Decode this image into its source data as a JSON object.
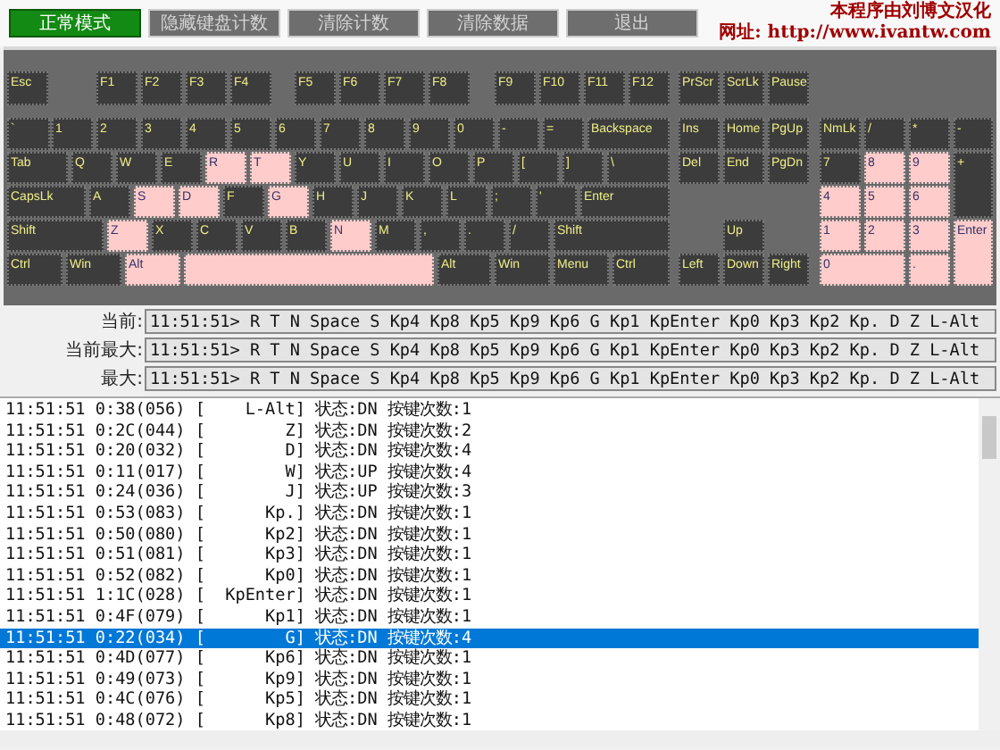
{
  "toolbar": {
    "buttons": [
      {
        "label": "正常模式",
        "selected": true,
        "disabled": false
      },
      {
        "label": "隐藏键盘计数",
        "selected": false,
        "disabled": true
      },
      {
        "label": "清除计数",
        "selected": false,
        "disabled": true
      },
      {
        "label": "清除数据",
        "selected": false,
        "disabled": true
      },
      {
        "label": "退出",
        "selected": false,
        "disabled": true
      }
    ],
    "credits": [
      "本程序由刘博文汉化",
      "网址: http://www.ivantw.com"
    ]
  },
  "keyboard": {
    "keys": [
      {
        "label": "Esc",
        "pressed": false
      },
      {
        "label": "F1",
        "pressed": false
      },
      {
        "label": "F2",
        "pressed": false
      },
      {
        "label": "F3",
        "pressed": false
      },
      {
        "label": "F4",
        "pressed": false
      },
      {
        "label": "F5",
        "pressed": false
      },
      {
        "label": "F6",
        "pressed": false
      },
      {
        "label": "F7",
        "pressed": false
      },
      {
        "label": "F8",
        "pressed": false
      },
      {
        "label": "F9",
        "pressed": false
      },
      {
        "label": "F10",
        "pressed": false
      },
      {
        "label": "F11",
        "pressed": false
      },
      {
        "label": "F12",
        "pressed": false
      },
      {
        "label": "PrScr",
        "pressed": false
      },
      {
        "label": "ScrLk",
        "pressed": false
      },
      {
        "label": "Pause",
        "pressed": false
      },
      {
        "label": "`",
        "pressed": false
      },
      {
        "label": "1",
        "pressed": false
      },
      {
        "label": "2",
        "pressed": false
      },
      {
        "label": "3",
        "pressed": false
      },
      {
        "label": "4",
        "pressed": false
      },
      {
        "label": "5",
        "pressed": false
      },
      {
        "label": "6",
        "pressed": false
      },
      {
        "label": "7",
        "pressed": false
      },
      {
        "label": "8",
        "pressed": false
      },
      {
        "label": "9",
        "pressed": false
      },
      {
        "label": "0",
        "pressed": false
      },
      {
        "label": "-",
        "pressed": false
      },
      {
        "label": "=",
        "pressed": false
      },
      {
        "label": "Backspace",
        "pressed": false
      },
      {
        "label": "Ins",
        "pressed": false
      },
      {
        "label": "Home",
        "pressed": false
      },
      {
        "label": "PgUp",
        "pressed": false
      },
      {
        "label": "NmLk",
        "pressed": false
      },
      {
        "label": "/",
        "pressed": false
      },
      {
        "label": "*",
        "pressed": false
      },
      {
        "label": "-",
        "pressed": false
      },
      {
        "label": "Tab",
        "pressed": false
      },
      {
        "label": "Q",
        "pressed": false
      },
      {
        "label": "W",
        "pressed": false
      },
      {
        "label": "E",
        "pressed": false
      },
      {
        "label": "R",
        "pressed": true
      },
      {
        "label": "T",
        "pressed": true
      },
      {
        "label": "Y",
        "pressed": false
      },
      {
        "label": "U",
        "pressed": false
      },
      {
        "label": "I",
        "pressed": false
      },
      {
        "label": "O",
        "pressed": false
      },
      {
        "label": "P",
        "pressed": false
      },
      {
        "label": "[",
        "pressed": false
      },
      {
        "label": "]",
        "pressed": false
      },
      {
        "label": "\\",
        "pressed": false
      },
      {
        "label": "Del",
        "pressed": false
      },
      {
        "label": "End",
        "pressed": false
      },
      {
        "label": "PgDn",
        "pressed": false
      },
      {
        "label": "7",
        "pressed": false
      },
      {
        "label": "8",
        "pressed": true
      },
      {
        "label": "9",
        "pressed": true
      },
      {
        "label": "+",
        "pressed": false
      },
      {
        "label": "CapsLk",
        "pressed": false
      },
      {
        "label": "A",
        "pressed": false
      },
      {
        "label": "S",
        "pressed": true
      },
      {
        "label": "D",
        "pressed": true
      },
      {
        "label": "F",
        "pressed": false
      },
      {
        "label": "G",
        "pressed": true
      },
      {
        "label": "H",
        "pressed": false
      },
      {
        "label": "J",
        "pressed": false
      },
      {
        "label": "K",
        "pressed": false
      },
      {
        "label": "L",
        "pressed": false
      },
      {
        "label": ";",
        "pressed": false
      },
      {
        "label": "'",
        "pressed": false
      },
      {
        "label": "Enter",
        "pressed": false
      },
      {
        "label": "4",
        "pressed": true
      },
      {
        "label": "5",
        "pressed": true
      },
      {
        "label": "6",
        "pressed": true
      },
      {
        "label": "Shift",
        "pressed": false
      },
      {
        "label": "Z",
        "pressed": true
      },
      {
        "label": "X",
        "pressed": false
      },
      {
        "label": "C",
        "pressed": false
      },
      {
        "label": "V",
        "pressed": false
      },
      {
        "label": "B",
        "pressed": false
      },
      {
        "label": "N",
        "pressed": true
      },
      {
        "label": "M",
        "pressed": false
      },
      {
        "label": ",",
        "pressed": false
      },
      {
        "label": ".",
        "pressed": false
      },
      {
        "label": "/",
        "pressed": false
      },
      {
        "label": "Shift",
        "pressed": false
      },
      {
        "label": "Up",
        "pressed": false
      },
      {
        "label": "1",
        "pressed": true
      },
      {
        "label": "2",
        "pressed": true
      },
      {
        "label": "3",
        "pressed": true
      },
      {
        "label": "Enter",
        "pressed": true
      },
      {
        "label": "Ctrl",
        "pressed": false
      },
      {
        "label": "Win",
        "pressed": false
      },
      {
        "label": "Alt",
        "pressed": true
      },
      {
        "pressed": true
      },
      {
        "label": "Alt",
        "pressed": false
      },
      {
        "label": "Win",
        "pressed": false
      },
      {
        "label": "Menu",
        "pressed": false
      },
      {
        "label": "Ctrl",
        "pressed": false
      },
      {
        "label": "Left",
        "pressed": false
      },
      {
        "label": "Down",
        "pressed": false
      },
      {
        "label": "Right",
        "pressed": false
      },
      {
        "label": "0",
        "pressed": true
      },
      {
        "label": ".",
        "pressed": true
      }
    ]
  },
  "readouts": [
    {
      "label": "当前:",
      "value": "11:51:51> R T N Space S Kp4 Kp8 Kp5 Kp9 Kp6 G Kp1 KpEnter Kp0 Kp3 Kp2 Kp. D Z L-Alt"
    },
    {
      "label": "当前最大:",
      "value": "11:51:51> R T N Space S Kp4 Kp8 Kp5 Kp9 Kp6 G Kp1 KpEnter Kp0 Kp3 Kp2 Kp. D Z L-Alt"
    },
    {
      "label": "最大:",
      "value": "11:51:51> R T N Space S Kp4 Kp8 Kp5 Kp9 Kp6 G Kp1 KpEnter Kp0 Kp3 Kp2 Kp. D Z L-Alt"
    }
  ],
  "log": [
    {
      "text": "11:51:51 0:38(056) [    L-Alt] 状态:DN 按键次数:1",
      "selected": false
    },
    {
      "text": "11:51:51 0:2C(044) [        Z] 状态:DN 按键次数:2",
      "selected": false
    },
    {
      "text": "11:51:51 0:20(032) [        D] 状态:DN 按键次数:4",
      "selected": false
    },
    {
      "text": "11:51:51 0:11(017) [        W] 状态:UP 按键次数:4",
      "selected": false
    },
    {
      "text": "11:51:51 0:24(036) [        J] 状态:UP 按键次数:3",
      "selected": false
    },
    {
      "text": "11:51:51 0:53(083) [      Kp.] 状态:DN 按键次数:1",
      "selected": false
    },
    {
      "text": "11:51:51 0:50(080) [      Kp2] 状态:DN 按键次数:1",
      "selected": false
    },
    {
      "text": "11:51:51 0:51(081) [      Kp3] 状态:DN 按键次数:1",
      "selected": false
    },
    {
      "text": "11:51:51 0:52(082) [      Kp0] 状态:DN 按键次数:1",
      "selected": false
    },
    {
      "text": "11:51:51 1:1C(028) [  KpEnter] 状态:DN 按键次数:1",
      "selected": false
    },
    {
      "text": "11:51:51 0:4F(079) [      Kp1] 状态:DN 按键次数:1",
      "selected": false
    },
    {
      "text": "11:51:51 0:22(034) [        G] 状态:DN 按键次数:4",
      "selected": true
    },
    {
      "text": "11:51:51 0:4D(077) [      Kp6] 状态:DN 按键次数:1",
      "selected": false
    },
    {
      "text": "11:51:51 0:49(073) [      Kp9] 状态:DN 按键次数:1",
      "selected": false
    },
    {
      "text": "11:51:51 0:4C(076) [      Kp5] 状态:DN 按键次数:1",
      "selected": false
    },
    {
      "text": "11:51:51 0:48(072) [      Kp8] 状态:DN 按键次数:1",
      "selected": false
    }
  ]
}
